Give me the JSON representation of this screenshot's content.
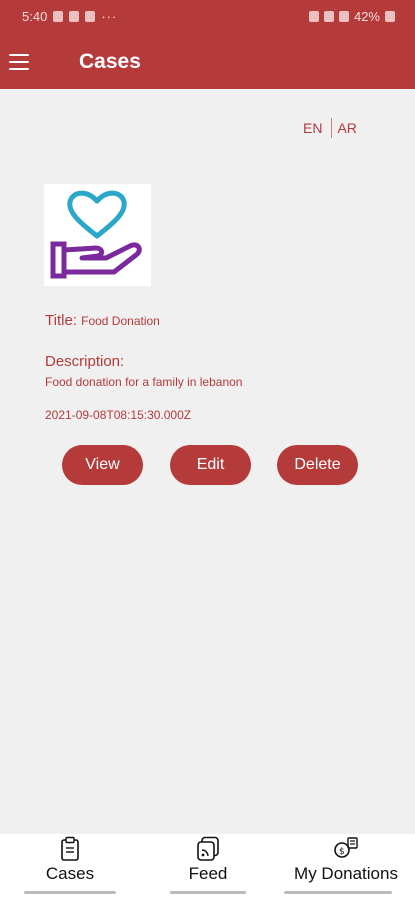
{
  "status_bar": {
    "time": "5:40",
    "more": "···",
    "battery": "42%"
  },
  "app_bar": {
    "title": "Cases",
    "menu_icon": "hamburger-menu-icon"
  },
  "language": {
    "en": "EN",
    "ar": "AR"
  },
  "case": {
    "image_icon": "heart-in-hand-icon",
    "title_label": "Title:",
    "title_value": "Food Donation",
    "description_label": "Description:",
    "description_value": "Food donation for a family in lebanon",
    "date": "2021-09-08T08:15:30.000Z"
  },
  "actions": {
    "view": "View",
    "edit": "Edit",
    "delete": "Delete"
  },
  "bottom_nav": [
    {
      "label": "Cases",
      "icon": "clipboard-icon"
    },
    {
      "label": "Feed",
      "icon": "feed-icon"
    },
    {
      "label": "My Donations",
      "icon": "donations-icon"
    }
  ],
  "colors": {
    "primary": "#b53a3a",
    "background": "#f0f0f0",
    "heart": "#2aa7c9",
    "hand": "#7b2a9e"
  }
}
